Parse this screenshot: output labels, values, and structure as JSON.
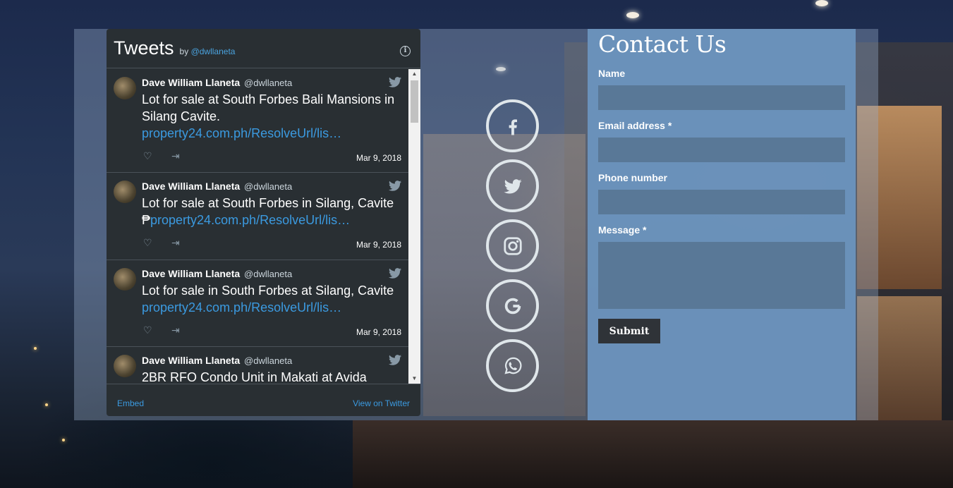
{
  "twitter_widget": {
    "title": "Tweets",
    "by_prefix": "by",
    "by_handle": "@dwllaneta",
    "info_icon": "info-icon",
    "tweets": [
      {
        "name": "Dave William Llaneta",
        "handle": "@dwllaneta",
        "text": "Lot for sale at South Forbes Bali Mansions in Silang Cavite.",
        "link": "property24.com.ph/ResolveUrl/lis…",
        "date": "Mar 9, 2018"
      },
      {
        "name": "Dave William Llaneta",
        "handle": "@dwllaneta",
        "text": "Lot for sale at South Forbes in Silang, Cavite ₱",
        "link": "property24.com.ph/ResolveUrl/lis…",
        "date": "Mar 9, 2018"
      },
      {
        "name": "Dave William Llaneta",
        "handle": "@dwllaneta",
        "text": "Lot for sale in South Forbes at Silang, Cavite",
        "link": "property24.com.ph/ResolveUrl/lis…",
        "date": "Mar 9, 2018"
      },
      {
        "name": "Dave William Llaneta",
        "handle": "@dwllaneta",
        "text": "2BR RFO Condo Unit in Makati at Avida",
        "link": "",
        "date": ""
      }
    ],
    "embed_label": "Embed",
    "view_label": "View on Twitter"
  },
  "social": [
    {
      "name": "facebook",
      "icon": "facebook-icon"
    },
    {
      "name": "twitter",
      "icon": "twitter-icon"
    },
    {
      "name": "instagram",
      "icon": "instagram-icon"
    },
    {
      "name": "google",
      "icon": "google-icon"
    },
    {
      "name": "whatsapp",
      "icon": "whatsapp-icon"
    }
  ],
  "contact": {
    "title": "Contact Us",
    "name_label": "Name",
    "email_label": "Email address *",
    "phone_label": "Phone number",
    "message_label": "Message *",
    "name_value": "",
    "email_value": "",
    "phone_value": "",
    "message_value": "",
    "submit_label": "Submit"
  },
  "colors": {
    "widget_bg": "#292f33",
    "link": "#3b9ae0",
    "contact_bg": "#6c93be",
    "input_bg": "#597897",
    "button_bg": "#2f3338"
  }
}
